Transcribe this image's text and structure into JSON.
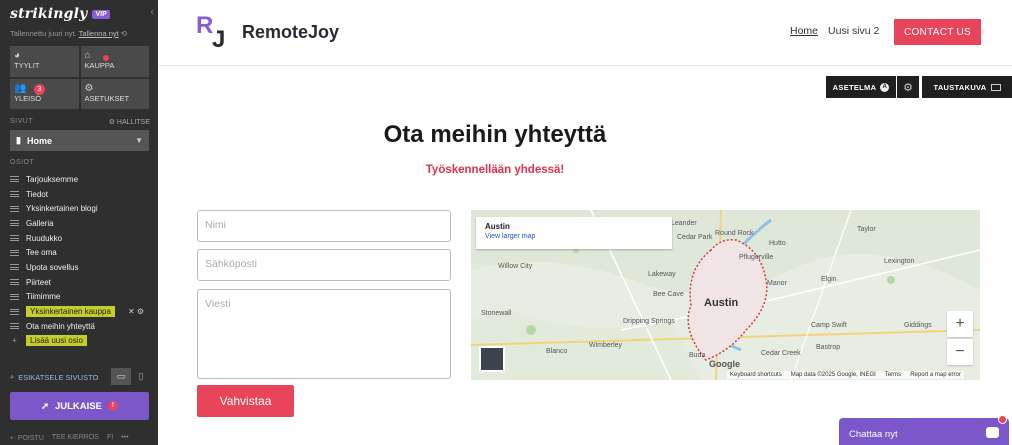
{
  "sidebar": {
    "logo": "strikingly",
    "vip": "VIP",
    "saved_text": "Tallennettu juuri nyt.",
    "save_now": "Tallenna nyt",
    "tools": [
      {
        "label": "TYYLIT",
        "icon": "palette-icon"
      },
      {
        "label": "KAUPPA",
        "icon": "store-icon"
      },
      {
        "label": "YLEISÖ",
        "icon": "users-icon",
        "badge": "3"
      },
      {
        "label": "ASETUKSET",
        "icon": "gear-icon"
      }
    ],
    "pages_label": "SIVUT",
    "manage_label": "HALLITSE",
    "current_page": "Home",
    "sections_label": "OSIOT",
    "sections": [
      "Tarjouksemme",
      "Tiedot",
      "Yksinkertainen blogi",
      "Galleria",
      "Ruudukko",
      "Tee oma",
      "Upota sovellus",
      "Piirteet",
      "Tiimimme",
      "Yksinkertainen kauppa",
      "Ota meihin yhteyttä"
    ],
    "add_section": "Lisää uusi osio",
    "preview": "ESIKATSELE SIVUSTO",
    "publish": "JULKAISE",
    "publish_badge": "!",
    "footer": [
      "POISTU",
      "TEE KIERROS",
      "FI",
      "•••"
    ]
  },
  "header": {
    "brand": "RemoteJoy",
    "brand_mark": "RJ",
    "nav": [
      "Home",
      "Uusi sivu 2"
    ],
    "contact": "CONTACT US"
  },
  "editor": {
    "layout": "ASETELMA",
    "layout_icon": "A",
    "background": "TAUSTAKUVA"
  },
  "content": {
    "title": "Ota meihin yhteyttä",
    "subtitle": "Työskennellään yhdessä!",
    "name_placeholder": "Nimi",
    "email_placeholder": "Sähköposti",
    "message_placeholder": "Viesti",
    "submit": "Vahvistaa"
  },
  "map": {
    "city": "Austin",
    "larger": "View larger map",
    "places": [
      "Austin",
      "Round Rock",
      "Cedar Park",
      "Hutto",
      "Pflugerville",
      "Leander",
      "Lakeway",
      "Bee Cave",
      "Willow City",
      "Stonewall",
      "Blanco",
      "Dripping Springs",
      "Buda",
      "Cedar Creek",
      "Bastrop",
      "Camp Swift",
      "Giddings",
      "Elgin",
      "Manor",
      "Lexington",
      "Taylor",
      "Wimberley"
    ],
    "zoom_in": "+",
    "zoom_out": "−",
    "google": "Google",
    "footer": [
      "Keyboard shortcuts",
      "Map data ©2025 Google, INEGI",
      "Terms",
      "Report a map error"
    ]
  },
  "chat": {
    "label": "Chattaa nyt"
  },
  "colors": {
    "accent": "#e8445a",
    "purple": "#7b57c9",
    "sidebar": "#2f2f2f"
  }
}
